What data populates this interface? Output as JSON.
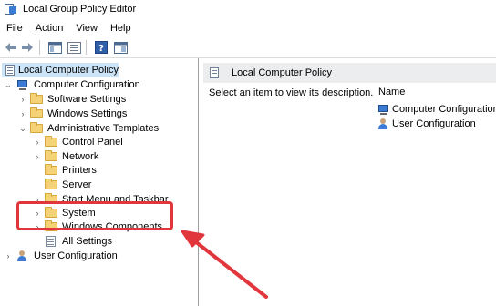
{
  "window": {
    "title": "Local Group Policy Editor"
  },
  "menu": [
    "File",
    "Action",
    "View",
    "Help"
  ],
  "toolbar": {
    "buttons": [
      "back-arrow-icon",
      "forward-arrow-icon",
      "show-hide-tree-icon",
      "properties-icon",
      "help-icon",
      "extended-view-icon"
    ]
  },
  "tree": [
    {
      "label": "Local Computer Policy",
      "icon": "policy-icon",
      "expander": "",
      "level": 0,
      "selected": true
    },
    {
      "label": "Computer Configuration",
      "icon": "computer-icon",
      "expander": "expanded",
      "level": 1
    },
    {
      "label": "Software Settings",
      "icon": "folder-icon",
      "expander": "collapsed",
      "level": 2
    },
    {
      "label": "Windows Settings",
      "icon": "folder-icon",
      "expander": "collapsed",
      "level": 2
    },
    {
      "label": "Administrative Templates",
      "icon": "folder-icon",
      "expander": "expanded",
      "level": 2
    },
    {
      "label": "Control Panel",
      "icon": "folder-icon",
      "expander": "collapsed",
      "level": 3
    },
    {
      "label": "Network",
      "icon": "folder-icon",
      "expander": "collapsed",
      "level": 3
    },
    {
      "label": "Printers",
      "icon": "folder-icon",
      "expander": "",
      "level": 3
    },
    {
      "label": "Server",
      "icon": "folder-icon",
      "expander": "",
      "level": 3
    },
    {
      "label": "Start Menu and Taskbar",
      "icon": "folder-icon",
      "expander": "collapsed",
      "level": 3
    },
    {
      "label": "System",
      "icon": "folder-icon",
      "expander": "collapsed",
      "level": 3
    },
    {
      "label": "Windows Components",
      "icon": "folder-icon",
      "expander": "collapsed",
      "level": 3
    },
    {
      "label": "All Settings",
      "icon": "settings-icon",
      "expander": "",
      "level": 3
    },
    {
      "label": "User Configuration",
      "icon": "user-icon",
      "expander": "collapsed",
      "level": 1
    }
  ],
  "right_pane": {
    "header": "Local Computer Policy",
    "description": "Select an item to view its description.",
    "column_name": "Name",
    "items": [
      {
        "label": "Computer Configuration",
        "icon": "computer-icon"
      },
      {
        "label": "User Configuration",
        "icon": "user-icon"
      }
    ]
  },
  "annotation": {
    "color": "#e2363d"
  }
}
